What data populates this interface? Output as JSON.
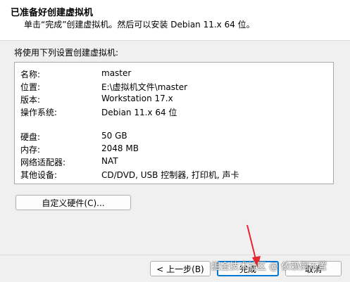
{
  "header": {
    "title": "已准备好创建虚拟机",
    "subtitle": "单击“完成”创建虚拟机。然后可以安装 Debian 11.x 64 位。"
  },
  "summary": {
    "label": "将使用下列设置创建虚拟机:",
    "rows": [
      {
        "key": "名称:",
        "value": "master"
      },
      {
        "key": "位置:",
        "value": "E:\\虚拟机文件\\master"
      },
      {
        "key": "版本:",
        "value": "Workstation 17.x"
      },
      {
        "key": "操作系统:",
        "value": "Debian 11.x 64 位"
      },
      {
        "key": "硬盘:",
        "value": "50 GB"
      },
      {
        "key": "内存:",
        "value": "2048 MB"
      },
      {
        "key": "网络适配器:",
        "value": "NAT"
      },
      {
        "key": "其他设备:",
        "value": "CD/DVD, USB 控制器, 打印机, 声卡"
      }
    ]
  },
  "buttons": {
    "customize": "自定义硬件(C)...",
    "back": "< 上一步(B)",
    "finish": "完成",
    "cancel": "取消"
  },
  "watermark": "掘金技术社区 @ 依赖倒不置",
  "colors": {
    "accent": "#0078d4",
    "annotation_arrow": "#e8262f"
  }
}
